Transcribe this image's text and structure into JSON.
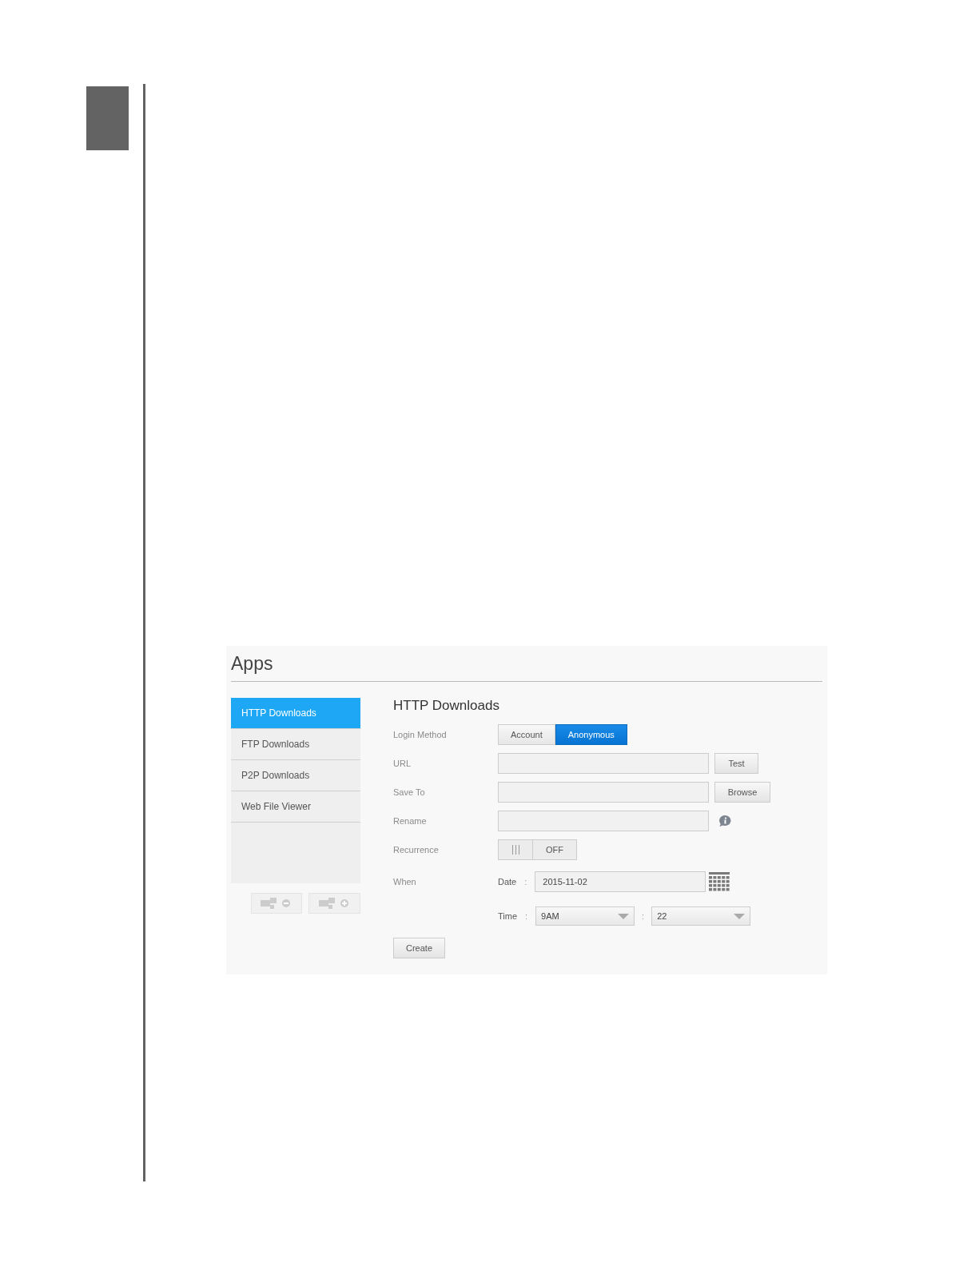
{
  "app": {
    "title": "Apps",
    "nav": [
      {
        "label": "HTTP Downloads",
        "selected": true
      },
      {
        "label": "FTP Downloads",
        "selected": false
      },
      {
        "label": "P2P Downloads",
        "selected": false
      },
      {
        "label": "Web File Viewer",
        "selected": false
      }
    ],
    "form": {
      "heading": "HTTP Downloads",
      "login_method": {
        "label": "Login Method",
        "options": [
          {
            "label": "Account",
            "selected": false
          },
          {
            "label": "Anonymous",
            "selected": true
          }
        ]
      },
      "url": {
        "label": "URL",
        "button": "Test"
      },
      "save_to": {
        "label": "Save To",
        "button": "Browse"
      },
      "rename": {
        "label": "Rename"
      },
      "recurrence": {
        "label": "Recurrence",
        "on": false,
        "state_text": "OFF"
      },
      "when": {
        "label": "When",
        "date_label": "Date",
        "date_separator": ":",
        "date": "2015-11-02",
        "time_label": "Time",
        "time_separator": ":",
        "hour": "9AM",
        "hour_minute_separator": ":",
        "minute": "22"
      },
      "create_button": "Create"
    }
  }
}
